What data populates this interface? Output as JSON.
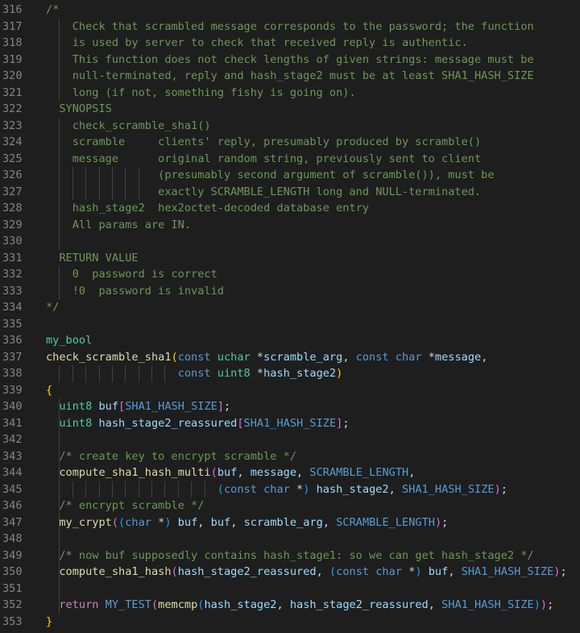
{
  "colors": {
    "background": "#1e1e1e",
    "line_number": "#858585",
    "comment": "#6a9955",
    "type": "#4ec9b0",
    "keyword": "#569cd6",
    "control": "#c586c0",
    "function": "#dcdcaa",
    "variable": "#9cdcfe",
    "macro": "#569cd6",
    "plain": "#d4d4d4",
    "bracket1": "#ffd700",
    "bracket2": "#da70d6",
    "bracket3": "#179fff",
    "indent_guide": "#404040"
  },
  "lines": [
    {
      "n": "316",
      "g": [],
      "tokens": [
        [
          "comment",
          "/*"
        ]
      ]
    },
    {
      "n": "317",
      "g": [
        1
      ],
      "tokens": [
        [
          "comment",
          "    Check that scrambled message corresponds to the password; the function"
        ]
      ]
    },
    {
      "n": "318",
      "g": [
        1
      ],
      "tokens": [
        [
          "comment",
          "    is used by server to check that received reply is authentic."
        ]
      ]
    },
    {
      "n": "319",
      "g": [
        1
      ],
      "tokens": [
        [
          "comment",
          "    This function does not check lengths of given strings: message must be"
        ]
      ]
    },
    {
      "n": "320",
      "g": [
        1
      ],
      "tokens": [
        [
          "comment",
          "    null-terminated, reply and hash_stage2 must be at least SHA1_HASH_SIZE"
        ]
      ]
    },
    {
      "n": "321",
      "g": [
        1
      ],
      "tokens": [
        [
          "comment",
          "    long (if not, something fishy is going on)."
        ]
      ]
    },
    {
      "n": "322",
      "g": [],
      "tokens": [
        [
          "comment",
          "  SYNOPSIS"
        ]
      ]
    },
    {
      "n": "323",
      "g": [
        1
      ],
      "tokens": [
        [
          "comment",
          "    check_scramble_sha1()"
        ]
      ]
    },
    {
      "n": "324",
      "g": [
        1
      ],
      "tokens": [
        [
          "comment",
          "    scramble     clients' reply, presumably produced by scramble()"
        ]
      ]
    },
    {
      "n": "325",
      "g": [
        1
      ],
      "tokens": [
        [
          "comment",
          "    message      original random string, previously sent to client"
        ]
      ]
    },
    {
      "n": "326",
      "g": [
        1,
        2,
        3,
        4,
        5,
        6,
        7
      ],
      "tokens": [
        [
          "comment",
          "                 (presumably second argument of scramble()), must be"
        ]
      ]
    },
    {
      "n": "327",
      "g": [
        1,
        2,
        3,
        4,
        5,
        6,
        7
      ],
      "tokens": [
        [
          "comment",
          "                 exactly SCRAMBLE_LENGTH long and NULL-terminated."
        ]
      ]
    },
    {
      "n": "328",
      "g": [
        1
      ],
      "tokens": [
        [
          "comment",
          "    hash_stage2  hex2octet-decoded database entry"
        ]
      ]
    },
    {
      "n": "329",
      "g": [
        1
      ],
      "tokens": [
        [
          "comment",
          "    All params are IN."
        ]
      ]
    },
    {
      "n": "330",
      "g": [
        1
      ],
      "tokens": []
    },
    {
      "n": "331",
      "g": [],
      "tokens": [
        [
          "comment",
          "  RETURN VALUE"
        ]
      ]
    },
    {
      "n": "332",
      "g": [
        1
      ],
      "tokens": [
        [
          "comment",
          "    0  password is correct"
        ]
      ]
    },
    {
      "n": "333",
      "g": [
        1
      ],
      "tokens": [
        [
          "comment",
          "    !0  password is invalid"
        ]
      ]
    },
    {
      "n": "334",
      "g": [],
      "tokens": [
        [
          "comment",
          "*/"
        ]
      ]
    },
    {
      "n": "335",
      "g": [],
      "tokens": []
    },
    {
      "n": "336",
      "g": [],
      "tokens": [
        [
          "type",
          "my_bool"
        ]
      ]
    },
    {
      "n": "337",
      "g": [],
      "tokens": [
        [
          "func",
          "check_scramble_sha1"
        ],
        [
          "bracket1",
          "("
        ],
        [
          "kw",
          "const"
        ],
        [
          "plain",
          " "
        ],
        [
          "type",
          "uchar"
        ],
        [
          "plain",
          " *"
        ],
        [
          "var",
          "scramble_arg"
        ],
        [
          "plain",
          ", "
        ],
        [
          "kw",
          "const"
        ],
        [
          "plain",
          " "
        ],
        [
          "kw",
          "char"
        ],
        [
          "plain",
          " *"
        ],
        [
          "var",
          "message"
        ],
        [
          "plain",
          ","
        ]
      ]
    },
    {
      "n": "338",
      "g": [
        1,
        2,
        3,
        4,
        5,
        6,
        7,
        8,
        9
      ],
      "tokens": [
        [
          "plain",
          "                    "
        ],
        [
          "kw",
          "const"
        ],
        [
          "plain",
          " "
        ],
        [
          "type",
          "uint8"
        ],
        [
          "plain",
          " *"
        ],
        [
          "var",
          "hash_stage2"
        ],
        [
          "bracket1",
          ")"
        ]
      ]
    },
    {
      "n": "339",
      "g": [],
      "tokens": [
        [
          "bracket1",
          "{"
        ]
      ]
    },
    {
      "n": "340",
      "g": [
        1
      ],
      "tokens": [
        [
          "plain",
          "  "
        ],
        [
          "type",
          "uint8"
        ],
        [
          "plain",
          " "
        ],
        [
          "var",
          "buf"
        ],
        [
          "bracket2",
          "["
        ],
        [
          "macro",
          "SHA1_HASH_SIZE"
        ],
        [
          "bracket2",
          "]"
        ],
        [
          "plain",
          ";"
        ]
      ]
    },
    {
      "n": "341",
      "g": [
        1
      ],
      "tokens": [
        [
          "plain",
          "  "
        ],
        [
          "type",
          "uint8"
        ],
        [
          "plain",
          " "
        ],
        [
          "var",
          "hash_stage2_reassured"
        ],
        [
          "bracket2",
          "["
        ],
        [
          "macro",
          "SHA1_HASH_SIZE"
        ],
        [
          "bracket2",
          "]"
        ],
        [
          "plain",
          ";"
        ]
      ]
    },
    {
      "n": "342",
      "g": [
        1
      ],
      "tokens": []
    },
    {
      "n": "343",
      "g": [
        1
      ],
      "tokens": [
        [
          "plain",
          "  "
        ],
        [
          "comment",
          "/* create key to encrypt scramble */"
        ]
      ]
    },
    {
      "n": "344",
      "g": [
        1
      ],
      "tokens": [
        [
          "plain",
          "  "
        ],
        [
          "func",
          "compute_sha1_hash_multi"
        ],
        [
          "bracket2",
          "("
        ],
        [
          "var",
          "buf"
        ],
        [
          "plain",
          ", "
        ],
        [
          "var",
          "message"
        ],
        [
          "plain",
          ", "
        ],
        [
          "macro",
          "SCRAMBLE_LENGTH"
        ],
        [
          "plain",
          ","
        ]
      ]
    },
    {
      "n": "345",
      "g": [
        1,
        2,
        3,
        4,
        5,
        6,
        7,
        8,
        9,
        10,
        11,
        12
      ],
      "tokens": [
        [
          "plain",
          "                          "
        ],
        [
          "bracket3",
          "("
        ],
        [
          "kw",
          "const"
        ],
        [
          "plain",
          " "
        ],
        [
          "kw",
          "char"
        ],
        [
          "plain",
          " *"
        ],
        [
          "bracket3",
          ")"
        ],
        [
          "plain",
          " "
        ],
        [
          "var",
          "hash_stage2"
        ],
        [
          "plain",
          ", "
        ],
        [
          "macro",
          "SHA1_HASH_SIZE"
        ],
        [
          "bracket2",
          ")"
        ],
        [
          "plain",
          ";"
        ]
      ]
    },
    {
      "n": "346",
      "g": [
        1
      ],
      "tokens": [
        [
          "plain",
          "  "
        ],
        [
          "comment",
          "/* encrypt scramble */"
        ]
      ]
    },
    {
      "n": "347",
      "g": [
        1
      ],
      "tokens": [
        [
          "plain",
          "  "
        ],
        [
          "func",
          "my_crypt"
        ],
        [
          "bracket2",
          "("
        ],
        [
          "bracket3",
          "("
        ],
        [
          "kw",
          "char"
        ],
        [
          "plain",
          " *"
        ],
        [
          "bracket3",
          ")"
        ],
        [
          "plain",
          " "
        ],
        [
          "var",
          "buf"
        ],
        [
          "plain",
          ", "
        ],
        [
          "var",
          "buf"
        ],
        [
          "plain",
          ", "
        ],
        [
          "var",
          "scramble_arg"
        ],
        [
          "plain",
          ", "
        ],
        [
          "macro",
          "SCRAMBLE_LENGTH"
        ],
        [
          "bracket2",
          ")"
        ],
        [
          "plain",
          ";"
        ]
      ]
    },
    {
      "n": "348",
      "g": [
        1
      ],
      "tokens": []
    },
    {
      "n": "349",
      "g": [
        1
      ],
      "tokens": [
        [
          "plain",
          "  "
        ],
        [
          "comment",
          "/* now buf supposedly contains hash_stage1: so we can get hash_stage2 */"
        ]
      ]
    },
    {
      "n": "350",
      "g": [
        1
      ],
      "tokens": [
        [
          "plain",
          "  "
        ],
        [
          "func",
          "compute_sha1_hash"
        ],
        [
          "bracket2",
          "("
        ],
        [
          "var",
          "hash_stage2_reassured"
        ],
        [
          "plain",
          ", "
        ],
        [
          "bracket3",
          "("
        ],
        [
          "kw",
          "const"
        ],
        [
          "plain",
          " "
        ],
        [
          "kw",
          "char"
        ],
        [
          "plain",
          " *"
        ],
        [
          "bracket3",
          ")"
        ],
        [
          "plain",
          " "
        ],
        [
          "var",
          "buf"
        ],
        [
          "plain",
          ", "
        ],
        [
          "macro",
          "SHA1_HASH_SIZE"
        ],
        [
          "bracket2",
          ")"
        ],
        [
          "plain",
          ";"
        ]
      ]
    },
    {
      "n": "351",
      "g": [
        1
      ],
      "tokens": []
    },
    {
      "n": "352",
      "g": [
        1
      ],
      "tokens": [
        [
          "plain",
          "  "
        ],
        [
          "ctrl",
          "return"
        ],
        [
          "plain",
          " "
        ],
        [
          "macro",
          "MY_TEST"
        ],
        [
          "bracket2",
          "("
        ],
        [
          "func",
          "memcmp"
        ],
        [
          "bracket3",
          "("
        ],
        [
          "var",
          "hash_stage2"
        ],
        [
          "plain",
          ", "
        ],
        [
          "var",
          "hash_stage2_reassured"
        ],
        [
          "plain",
          ", "
        ],
        [
          "macro",
          "SHA1_HASH_SIZE"
        ],
        [
          "bracket3",
          ")"
        ],
        [
          "bracket2",
          ")"
        ],
        [
          "plain",
          ";"
        ]
      ]
    },
    {
      "n": "353",
      "g": [],
      "tokens": [
        [
          "bracket1",
          "}"
        ]
      ]
    }
  ]
}
